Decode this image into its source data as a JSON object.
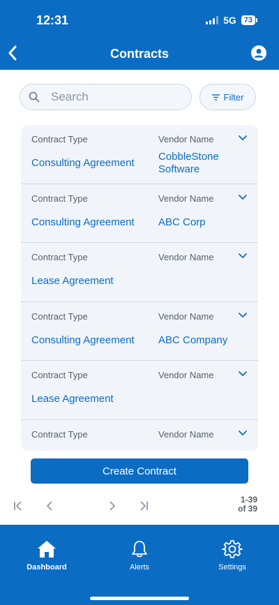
{
  "status": {
    "time": "12:31",
    "network": "5G",
    "battery": "73"
  },
  "header": {
    "title": "Contracts",
    "back_icon": "chevron-left-icon",
    "profile_icon": "user-circle-icon"
  },
  "search": {
    "placeholder": "Search",
    "value": ""
  },
  "filter": {
    "label": "Filter"
  },
  "contracts": [
    {
      "type_label": "Contract Type",
      "vendor_label": "Vendor Name",
      "type": "Consulting Agreement",
      "vendor": "CobbleStone Software"
    },
    {
      "type_label": "Contract Type",
      "vendor_label": "Vendor Name",
      "type": "Consulting Agreement",
      "vendor": "ABC Corp"
    },
    {
      "type_label": "Contract Type",
      "vendor_label": "Vendor Name",
      "type": "Lease Agreement",
      "vendor": ""
    },
    {
      "type_label": "Contract Type",
      "vendor_label": "Vendor Name",
      "type": "Consulting Agreement",
      "vendor": "ABC Company"
    },
    {
      "type_label": "Contract Type",
      "vendor_label": "Vendor Name",
      "type": "Lease Agreement",
      "vendor": ""
    },
    {
      "type_label": "Contract Type",
      "vendor_label": "Vendor Name",
      "type": "",
      "vendor": ""
    }
  ],
  "create_button": {
    "label": "Create Contract"
  },
  "pagination": {
    "range": "1-39",
    "total": "of 39"
  },
  "tabs": [
    {
      "label": "Dashboard",
      "icon": "home-icon",
      "active": true
    },
    {
      "label": "Alerts",
      "icon": "bell-icon",
      "active": false
    },
    {
      "label": "Settings",
      "icon": "gear-icon",
      "active": false
    }
  ],
  "colors": {
    "primary": "#0b6cc4",
    "card_bg": "#f1f5f9",
    "label_gray": "#555f6a"
  }
}
